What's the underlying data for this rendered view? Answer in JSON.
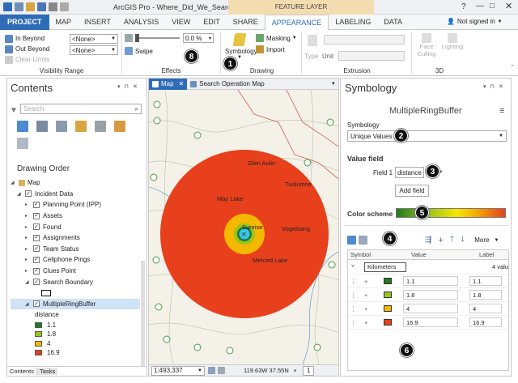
{
  "titlebar": {
    "title": "ArcGIS Pro - Where_Did_We_Search - Map",
    "context": "FEATURE LAYER",
    "help": "?"
  },
  "ribbon": {
    "tabs": [
      "PROJECT",
      "MAP",
      "INSERT",
      "ANALYSIS",
      "VIEW",
      "EDIT",
      "SHARE",
      "APPEARANCE",
      "LABELING",
      "DATA"
    ],
    "active_tab": "APPEARANCE",
    "signed_in": "Not signed in",
    "visibility": {
      "in_beyond": "In Beyond",
      "out_beyond": "Out Beyond",
      "clear_limits": "Clear Limits",
      "in_value": "<None>",
      "out_value": "<None>",
      "label": "Visibility Range"
    },
    "effects": {
      "transparency": "0.0 %",
      "swipe": "Swipe",
      "label": "Effects"
    },
    "drawing": {
      "symbology": "Symbology",
      "masking": "Masking",
      "import": "Import",
      "label": "Drawing"
    },
    "extrusion": {
      "type": "Type",
      "unit": "Unit",
      "label": "Extrusion"
    },
    "threed": {
      "face_culling": "Face Culling",
      "lighting": "Lighting",
      "label": "3D"
    }
  },
  "contents": {
    "title": "Contents",
    "search_placeholder": "Search",
    "drawing_order": "Drawing Order",
    "layers": [
      {
        "name": "Map",
        "level": 0
      },
      {
        "name": "Incident Data",
        "level": 1
      },
      {
        "name": "Planning Point (IPP)",
        "level": 2
      },
      {
        "name": "Assets",
        "level": 2
      },
      {
        "name": "Found",
        "level": 2
      },
      {
        "name": "Assignments",
        "level": 2
      },
      {
        "name": "Team Status",
        "level": 2
      },
      {
        "name": "Cellphone Pings",
        "level": 2
      },
      {
        "name": "Clues Point",
        "level": 2
      },
      {
        "name": "Search Boundary",
        "level": 2
      },
      {
        "name": "MultipleRingBuffer",
        "level": 2
      }
    ],
    "legend_field": "distance",
    "legend": [
      {
        "label": "1.1",
        "color": "#1e7b1e"
      },
      {
        "label": "1.8",
        "color": "#9ac31c"
      },
      {
        "label": "4",
        "color": "#f5b800"
      },
      {
        "label": "16.9",
        "color": "#e8401c"
      }
    ],
    "bottom_tabs": [
      "Contents",
      "Tasks"
    ]
  },
  "map": {
    "tabs": [
      "Map",
      "Search Operation Map"
    ],
    "places": [
      "Glen Aulin",
      "Tuolumne",
      "May Lake",
      "Sunrise",
      "Vogelsang",
      "Merced Lake"
    ],
    "scale": "1:493,337",
    "coords": "119.63W 37.55N",
    "page": "1"
  },
  "symbology": {
    "title": "Symbology",
    "layer": "MultipleRingBuffer",
    "symbology_label": "Symbology",
    "symbology_value": "Unique Values",
    "value_field_label": "Value field",
    "field1_label": "Field 1",
    "field1_value": "distance",
    "add_field": "Add field",
    "color_scheme_label": "Color scheme",
    "more": "More",
    "columns": {
      "symbol": "Symbol",
      "value": "Value",
      "label": "Label"
    },
    "group_name": "Kilometers",
    "group_count": "4 valu",
    "rows": [
      {
        "value": "1.1",
        "label": "1.1",
        "color": "#1e7b1e"
      },
      {
        "value": "1.8",
        "label": "1.8",
        "color": "#9ac31c"
      },
      {
        "value": "4",
        "label": "4",
        "color": "#f5b800"
      },
      {
        "value": "16.9",
        "label": "16.9",
        "color": "#e8401c"
      }
    ]
  },
  "callouts": [
    "1",
    "2",
    "3",
    "4",
    "5",
    "6",
    "8"
  ],
  "colors": {
    "accent": "#2f6cb8",
    "ring_outer": "#e8401c",
    "ring_4": "#f5b800",
    "ring_18": "#9ac31c",
    "ring_11": "#1e7b1e",
    "center": "#39c6e0"
  }
}
